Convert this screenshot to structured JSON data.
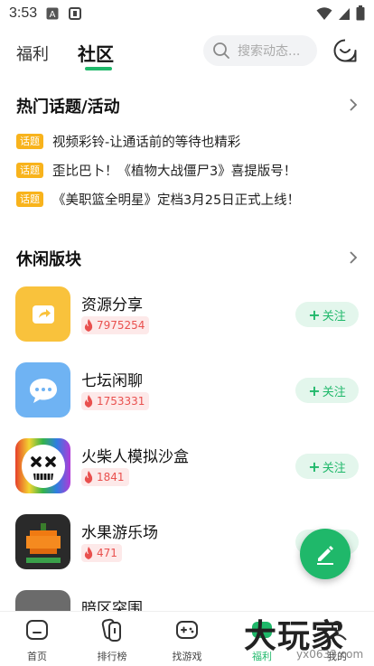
{
  "status_bar": {
    "time": "3:53"
  },
  "top_tabs": {
    "welfare": "福利",
    "community": "社区"
  },
  "search": {
    "placeholder": "搜索动态..."
  },
  "hot_topics": {
    "title": "热门话题/活动",
    "tag_label": "话题",
    "items": [
      "视频彩铃-让通话前的等待也精彩",
      "歪比巴卜！《植物大战僵尸3》喜提版号！",
      "《美职篮全明星》定档3月25日正式上线！"
    ]
  },
  "leisure": {
    "title": "休闲版块",
    "follow_label": "关注",
    "boards": [
      {
        "name": "资源分享",
        "heat": "7975254",
        "color": "#f9c23c"
      },
      {
        "name": "七坛闲聊",
        "heat": "1753331",
        "color": "#6fb3f3"
      },
      {
        "name": "火柴人模拟沙盒",
        "heat": "1841",
        "color": "#222222"
      },
      {
        "name": "水果游乐场",
        "heat": "471",
        "color": "#2a2a2a"
      },
      {
        "name": "暗区突围",
        "heat": "",
        "color": "#555555"
      }
    ]
  },
  "bottom_nav": {
    "items": [
      {
        "label": "首页",
        "icon": "home-icon"
      },
      {
        "label": "排行榜",
        "icon": "ranking-icon"
      },
      {
        "label": "找游戏",
        "icon": "gamepad-icon"
      },
      {
        "label": "福利",
        "icon": "welfare-icon"
      },
      {
        "label": "我的",
        "icon": "profile-icon"
      }
    ]
  },
  "watermark": {
    "big": "大玩家",
    "small": "yx0633.com"
  },
  "colors": {
    "accent": "#1fb86a",
    "tag": "#f8b31c",
    "heat": "#e9504e"
  }
}
